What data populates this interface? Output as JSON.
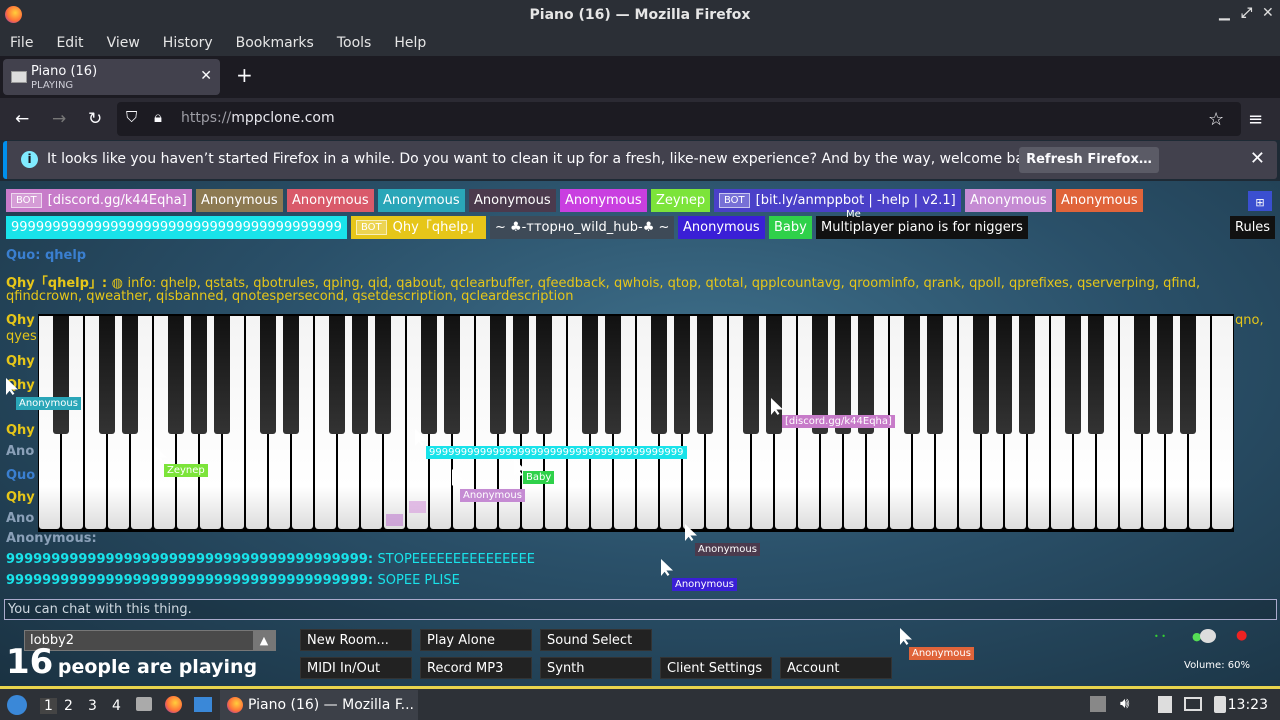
{
  "window": {
    "title": "Piano (16) — Mozilla Firefox"
  },
  "menu": [
    "File",
    "Edit",
    "View",
    "History",
    "Bookmarks",
    "Tools",
    "Help"
  ],
  "tab": {
    "title": "Piano (16)",
    "subtitle": "PLAYING"
  },
  "url": {
    "scheme": "https://",
    "host": "mppclone.com"
  },
  "infobar": {
    "message": "It looks like you haven’t started Firefox in a while. Do you want to clean it up for a fresh, like-new experience? And by the way, welcome back!",
    "button": "Refresh Firefox…"
  },
  "users_row1": [
    {
      "bot": true,
      "name": "[discord.gg/k44Eqha]",
      "color": "#c77bc9"
    },
    {
      "name": "Anonymous",
      "color": "#8d7a52"
    },
    {
      "name": "Anonymous",
      "color": "#d95a6a"
    },
    {
      "name": "Anonymous",
      "color": "#2aa6b8"
    },
    {
      "name": "Anonymous",
      "color": "#4b3a4d"
    },
    {
      "name": "Anonymous",
      "color": "#c93fe0"
    },
    {
      "name": "Zeynep",
      "color": "#7ce43a"
    },
    {
      "bot": true,
      "name": "[bit.ly/anmppbot | -help | v2.1]",
      "color": "#4a40c8"
    },
    {
      "name": "Anonymous",
      "color": "#c58bd3"
    },
    {
      "name": "Anonymous",
      "color": "#e0643a"
    }
  ],
  "users_row2": [
    {
      "name": "9999999999999999999999999999999999999999",
      "color": "#19e3ea"
    },
    {
      "bot": true,
      "name": "Qhy「qhelp」",
      "color": "#e6c619"
    },
    {
      "name": "~ ♣-ттоpно_wild_hub-♣ ~",
      "color": "#3e4a57"
    },
    {
      "name": "Anonymous",
      "color": "#3a1fd6"
    },
    {
      "name": "Baby",
      "color": "#2fd14a"
    },
    {
      "name": "Multiplayer piano is for niggers",
      "color": "#111111"
    }
  ],
  "me_label": "Me",
  "rules_button": "Rules",
  "chat": {
    "quota_line": "Quo: qhelp",
    "bot_name": "Qhy「qhelp」:",
    "bot_info": "info: qhelp, qstats, qbotrules, qping, qid, qabout, qclearbuffer, qfeedback, qwhois, qtop, qtotal, qpplcountavg, qroominfo, qrank, qpoll, qprefixes, qserverping, qfind,",
    "bot_info2": "qfindcrown, qweather, qisbanned, qnotespersecond, qsetdescription, qcleardescription",
    "side_lines": [
      "Qhy",
      "Qhy",
      "Qhy",
      "Qhy",
      "Ano",
      "Quo",
      "Qhy",
      "Ano"
    ],
    "side_right": "qno,",
    "side_right2": "qyes",
    "anon_line": "Anonymous:",
    "lines": [
      {
        "user": "9999999999999999999999999999999999999999:",
        "msg": "STOPEEEEEEEEEEEEEEE"
      },
      {
        "user": "9999999999999999999999999999999999999999:",
        "msg": "SOPEE PLISE"
      }
    ],
    "placeholder": "You can chat with this thing."
  },
  "cursors": [
    {
      "name": "Anonymous",
      "color": "#2aa6b8"
    },
    {
      "name": "Zeynep",
      "color": "#7ce43a"
    },
    {
      "name": "9999999999999999999999999999999999999999",
      "color": "#19e3ea"
    },
    {
      "name": "Anonymous",
      "color": "#c58bd3"
    },
    {
      "name": "Baby",
      "color": "#2fd14a"
    },
    {
      "name": "[discord.gg/k44Eqha]",
      "color": "#c77bc9"
    },
    {
      "name": "Anonymous",
      "color": "#4b3a4d"
    },
    {
      "name": "Anonymous",
      "color": "#3a1fd6"
    },
    {
      "name": "Anonymous",
      "color": "#e0643a"
    }
  ],
  "bottom": {
    "room": "lobby2",
    "count": "16",
    "count_label": "people are playing",
    "buttons_top": [
      "New Room...",
      "Play Alone",
      "Sound Select"
    ],
    "buttons_bottom": [
      "MIDI In/Out",
      "Record MP3",
      "Synth",
      "Client Settings",
      "Account"
    ],
    "volume": "Volume: 60%"
  },
  "taskbar": {
    "workspaces": [
      "1",
      "2",
      "3",
      "4"
    ],
    "window": "Piano (16) — Mozilla F...",
    "clock": "13:23"
  }
}
